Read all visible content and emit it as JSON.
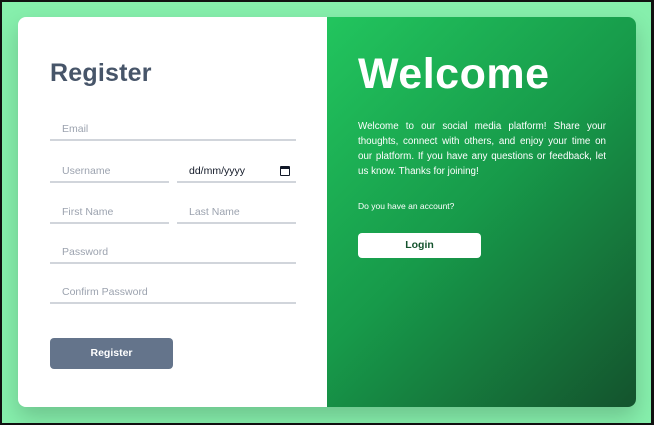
{
  "register": {
    "title": "Register",
    "fields": {
      "email": "Email",
      "username": "Username",
      "date": "dd/mm/yyyy",
      "first_name": "First Name",
      "last_name": "Last Name",
      "password": "Password",
      "confirm_password": "Confirm Password"
    },
    "button": "Register"
  },
  "welcome": {
    "title": "Welcome",
    "description": "Welcome to our social media platform! Share your thoughts, connect with others, and enjoy your time on our platform. If you have any questions or feedback, let us know. Thanks for joining!",
    "question": "Do you have an account?",
    "login_button": "Login"
  },
  "colors": {
    "background": "#86efac",
    "accent_start": "#22c55e",
    "accent_end": "#14532d",
    "register_button": "#64748b"
  },
  "icons": {
    "date": "calendar-icon"
  }
}
